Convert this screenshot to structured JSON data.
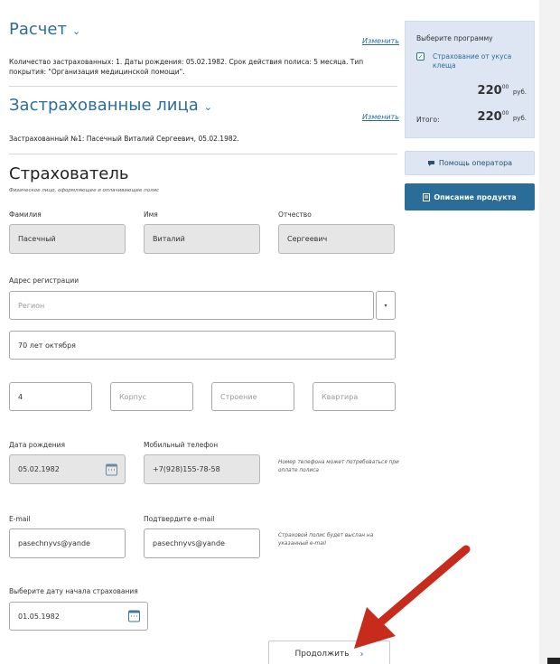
{
  "calc": {
    "title": "Расчет",
    "change_link": "Изменить",
    "summary": "Количество застрахованных: 1. Даты рождения: 05.02.1982. Срок действия полиса: 5 месяца. Тип покрытия: \"Организация медицинской помощи\"."
  },
  "insured": {
    "title": "Застрахованные лица",
    "change_link": "Изменить",
    "summary": "Застрахованный №1: Пасечный Виталий Сергеевич, 05.02.1982."
  },
  "policyholder": {
    "title": "Страхователь",
    "note": "Физическое лицо, оформляющее и оплачивающее полис",
    "surname_label": "Фамилия",
    "surname": "Пасечный",
    "name_label": "Имя",
    "name": "Виталий",
    "patronymic_label": "Отчество",
    "patronymic": "Сергеевич"
  },
  "address": {
    "label": "Адрес регистрации",
    "region_placeholder": "Регион",
    "dropdown_glyph": "▾",
    "street": "70 лет октября",
    "house": "4",
    "building_placeholder": "Корпус",
    "structure_placeholder": "Строение",
    "apartment_placeholder": "Квартира"
  },
  "birth": {
    "label": "Дата рождения",
    "value": "05.02.1982"
  },
  "phone": {
    "label": "Мобильный телефон",
    "value": "+7(928)155-78-58",
    "hint": "Номер телефона может потребоваться при оплате полиса"
  },
  "email": {
    "label": "E-mail",
    "value": "pasechnyvs@yande",
    "confirm_label": "Подтвердите e-mail",
    "confirm_value": "pasechnyvs@yande",
    "hint": "Страховой полис будет выслан на указанный e-mail"
  },
  "start": {
    "label": "Выберите дату начала страхования",
    "value": "01.05.1982"
  },
  "continue_button": {
    "label": "Продолжить",
    "arrow": "›"
  },
  "sidebar": {
    "choose_program": "Выберите программу",
    "program_name": "Страхование от укуса клеща",
    "program_price": "220",
    "program_kop": "00",
    "currency": "руб.",
    "total_label": "Итого:",
    "total_price": "220",
    "total_kop": "00",
    "operator_button": "Помощь оператора",
    "description_button": "Описание продукта"
  },
  "colors": {
    "accent": "#2b6e9a",
    "button_dark": "#2a6d98",
    "sidebar_box": "#dde6f2",
    "arrow": "#c62b1c"
  }
}
